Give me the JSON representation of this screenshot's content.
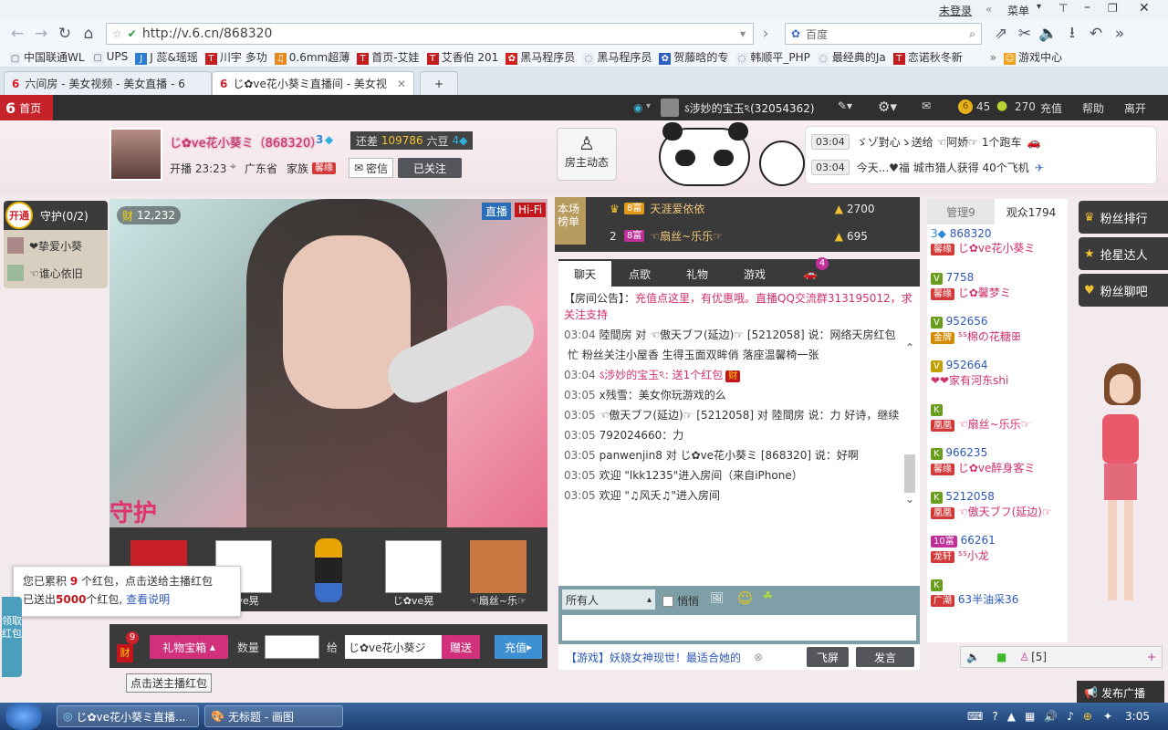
{
  "browser": {
    "top_right": [
      "未登录",
      "菜单"
    ],
    "url": "http://v.6.cn/868320",
    "search_placeholder": "百度",
    "bookmarks": [
      "中国联通WL",
      "UPS",
      "J 蕊&瑶瑶",
      "川宇 多功",
      "0.6mm超薄",
      "首页-艾娃",
      "艾香伯 201",
      "黑马程序员",
      "黑马程序员",
      "贺藤晗的专",
      "韩顺平_PHP",
      "最经典的Ja",
      "恋诺秋冬新",
      "游戏中心"
    ],
    "tabs": [
      {
        "title": "六间房 - 美女视频 - 美女直播 - 6"
      },
      {
        "title": "じ✿ve花小葵ミ直播间 - 美女视"
      }
    ]
  },
  "site": {
    "home": "首页",
    "user": "ऽ涉妙的宝玉ঽ(32054362)",
    "coins": "45",
    "beans": "270",
    "links": [
      "充值",
      "帮助",
      "离开"
    ]
  },
  "anchor": {
    "name": "じ✿ve花小葵ミ（868320）",
    "level": "3",
    "rank_label": "还差",
    "rank_value": "109786",
    "rank_suffix": "六豆",
    "start_label": "开播 23:23",
    "location": "广东省",
    "family_label": "家族",
    "family_tag": "馨缘",
    "msg": "密信",
    "follow": "已关注",
    "host_dynamics": "房主动态"
  },
  "notices": [
    {
      "time": "03:04",
      "text": "ゞゾ對心ゝ送给 ☜阿娇☞ 1个跑车"
    },
    {
      "time": "03:04",
      "text": "今天...♥福 城市猎人获得 40个飞机"
    }
  ],
  "guard": {
    "open": "开通",
    "title": "守护(0/2)",
    "members": [
      "❤挚爱小葵",
      "☜谁心依旧"
    ]
  },
  "video": {
    "cai_count": "12,232",
    "live": "直播",
    "hifi": "Hi-Fi",
    "guard_text": "守护"
  },
  "guard_gifts": [
    {
      "label": ""
    },
    {
      "label": "✿ve晃"
    },
    {
      "label": ""
    },
    {
      "label": "じ✿ve晃"
    },
    {
      "label": "☜扇丝~乐☞"
    }
  ],
  "redpack": {
    "line1_a": "您已累积 ",
    "line1_n": "9",
    "line1_b": " 个红包，点击送给主播红包",
    "line2_a": "已送出",
    "line2_n": "5000",
    "line2_b": "个红包,",
    "line2_link": "查看说明",
    "count": "9",
    "tooltip": "点击送主播红包",
    "side": "领取红包"
  },
  "giftbar": {
    "treasure": "礼物宝箱",
    "qty_label": "数量",
    "to_label": "给",
    "to_value": "じ✿ve花小葵ジ",
    "send": "赠送",
    "recharge": "充值"
  },
  "ranking": {
    "label": "本场榜单",
    "rows": [
      {
        "rank": "",
        "badge": "8富",
        "name": "天涯爱依依",
        "value": "2700"
      },
      {
        "rank": "2",
        "badge": "8富",
        "name": "☜扇丝~乐乐☞",
        "value": "695"
      }
    ]
  },
  "chat": {
    "tabs": [
      "聊天",
      "点歌",
      "礼物",
      "游戏"
    ],
    "car_count": "4",
    "announcement_label": "【房间公告】：",
    "announcement": "充值点这里，有优惠哦。直播QQ交流群313195012，求关注支持",
    "lines": [
      {
        "time": "03:04",
        "text": "陸間房 对 ☜傲天ブフ(延边)☞ [5212058] 说：网络天房红包"
      },
      {
        "time": "",
        "text": "忙  粉丝关注小屋香 生得玉面双眸俏 落座温馨椅一张"
      },
      {
        "time": "03:04",
        "text": "ऽ涉妙的宝玉ঽ: 送1个红包"
      },
      {
        "time": "03:05",
        "text": "x残雪：美女你玩游戏的么"
      },
      {
        "time": "03:05",
        "text": "☜傲天ブフ(延边)☞ [5212058] 对 陸間房 说：力 好诗，继续"
      },
      {
        "time": "03:05",
        "text": "792024660：力"
      },
      {
        "time": "03:05",
        "text": "panwenjin8 对 じ✿ve花小葵ミ [868320] 说：好啊"
      },
      {
        "time": "03:05",
        "text": "欢迎 \"lkk1235\"进入房间（来自iPhone）"
      },
      {
        "time": "03:05",
        "text": "欢迎 \"♫风夭♫\"进入房间"
      }
    ],
    "target": "所有人",
    "whisper": "悄悄",
    "game_notice": "【游戏】妖娆女神现世！最适合她的",
    "fly": "飞屏",
    "send": "发言"
  },
  "audience": {
    "tabs": [
      "管理9",
      "观众1794"
    ],
    "list": [
      {
        "id": "868320",
        "tag": "馨缘",
        "name": "じ✿ve花小葵ミ"
      },
      {
        "id": "7758",
        "tag": "馨缘",
        "name": "じ✿馨梦ミ"
      },
      {
        "id": "952656",
        "tag": "金牌",
        "name": "ᔆᔆ棉の花糖ꕥ"
      },
      {
        "id": "952664",
        "tag": "",
        "name": "❤❤家有河东shi"
      },
      {
        "id": "",
        "tag": "凰凰",
        "name": "☜扇丝~乐乐☞"
      },
      {
        "id": "966235",
        "tag": "馨缘",
        "name": "じ✿ve醉身客ミ"
      },
      {
        "id": "5212058",
        "tag": "凰凰",
        "name": "☜傲天ブフ(延边)☞"
      },
      {
        "id": "66261",
        "tag": "龙轩",
        "name": "ᔆᔆ小龙"
      },
      {
        "id": "",
        "tag": "广潮",
        "name": "63半油采36"
      }
    ],
    "online": "[5]"
  },
  "side_buttons": [
    "粉丝排行",
    "抢星达人",
    "粉丝聊吧"
  ],
  "broadcast": "发布广播",
  "taskbar": {
    "items": [
      "じ✿ve花小葵ミ直播...",
      "无标题 - 画图"
    ],
    "clock": "3:05"
  }
}
